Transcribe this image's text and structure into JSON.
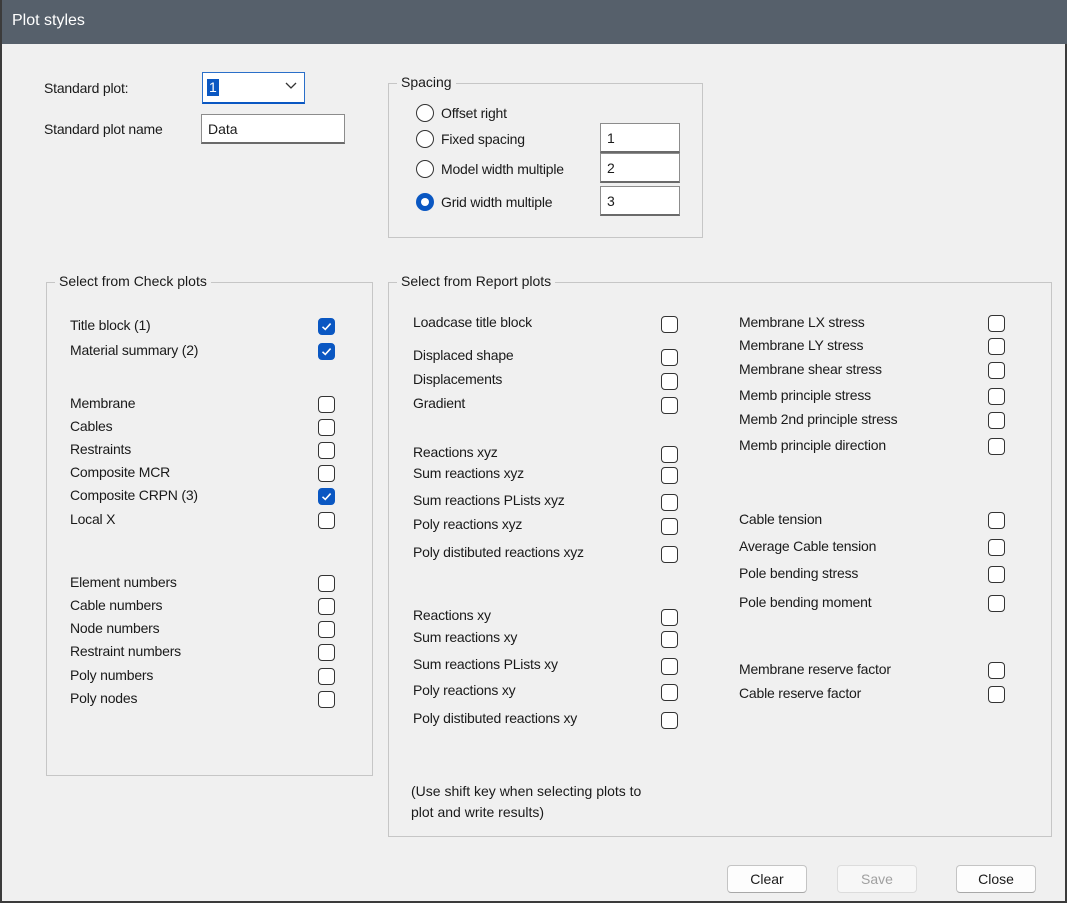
{
  "window": {
    "title": "Plot styles"
  },
  "standard_plot": {
    "label": "Standard plot:",
    "selected": "1"
  },
  "standard_plot_name": {
    "label": "Standard plot name",
    "value": "Data"
  },
  "spacing": {
    "title": "Spacing",
    "selected": "Grid width multiple",
    "options": [
      {
        "label": "Offset right",
        "value": ""
      },
      {
        "label": "Fixed spacing",
        "value": "1"
      },
      {
        "label": "Model width multiple",
        "value": "2"
      },
      {
        "label": "Grid width multiple",
        "value": "3"
      }
    ]
  },
  "check_plots": {
    "title": "Select from Check plots",
    "items": [
      {
        "label": "Title block (1)",
        "checked": true
      },
      {
        "label": "Material summary (2)",
        "checked": true
      },
      {
        "label": "Membrane",
        "checked": false
      },
      {
        "label": "Cables",
        "checked": false
      },
      {
        "label": "Restraints",
        "checked": false
      },
      {
        "label": "Composite MCR",
        "checked": false
      },
      {
        "label": "Composite CRPN (3)",
        "checked": true
      },
      {
        "label": "Local X",
        "checked": false
      },
      {
        "label": "Element numbers",
        "checked": false
      },
      {
        "label": "Cable numbers",
        "checked": false
      },
      {
        "label": "Node numbers",
        "checked": false
      },
      {
        "label": "Restraint numbers",
        "checked": false
      },
      {
        "label": "Poly numbers",
        "checked": false
      },
      {
        "label": "Poly nodes",
        "checked": false
      }
    ]
  },
  "report_plots": {
    "title": "Select from Report plots",
    "left_items": [
      {
        "label": "Loadcase title block",
        "checked": false
      },
      {
        "label": "Displaced shape",
        "checked": false
      },
      {
        "label": "Displacements",
        "checked": false
      },
      {
        "label": "Gradient",
        "checked": false
      },
      {
        "label": "Reactions xyz",
        "checked": false
      },
      {
        "label": "Sum reactions xyz",
        "checked": false
      },
      {
        "label": "Sum reactions PLists xyz",
        "checked": false
      },
      {
        "label": "Poly reactions xyz",
        "checked": false
      },
      {
        "label": "Poly distibuted reactions xyz",
        "checked": false
      },
      {
        "label": "Reactions xy",
        "checked": false
      },
      {
        "label": "Sum reactions xy",
        "checked": false
      },
      {
        "label": "Sum reactions PLists xy",
        "checked": false
      },
      {
        "label": "Poly reactions xy",
        "checked": false
      },
      {
        "label": "Poly distibuted reactions xy",
        "checked": false
      }
    ],
    "right_items": [
      {
        "label": "Membrane LX stress",
        "checked": false
      },
      {
        "label": "Membrane LY stress",
        "checked": false
      },
      {
        "label": "Membrane shear stress",
        "checked": false
      },
      {
        "label": "Memb principle stress",
        "checked": false
      },
      {
        "label": "Memb 2nd principle stress",
        "checked": false
      },
      {
        "label": "Memb principle direction",
        "checked": false
      },
      {
        "label": "Cable tension",
        "checked": false
      },
      {
        "label": "Average Cable tension",
        "checked": false
      },
      {
        "label": "Pole bending stress",
        "checked": false
      },
      {
        "label": "Pole bending moment",
        "checked": false
      },
      {
        "label": "Membrane reserve factor",
        "checked": false
      },
      {
        "label": "Cable reserve factor",
        "checked": false
      }
    ],
    "note_line1": "(Use shift key when selecting plots to",
    "note_line2": "plot and write results)"
  },
  "buttons": {
    "clear": "Clear",
    "save": "Save",
    "close": "Close",
    "save_enabled": false
  },
  "colors": {
    "titlebar": "#56606b",
    "accent": "#0a57c2",
    "dialog_bg": "#f0f0f0"
  }
}
